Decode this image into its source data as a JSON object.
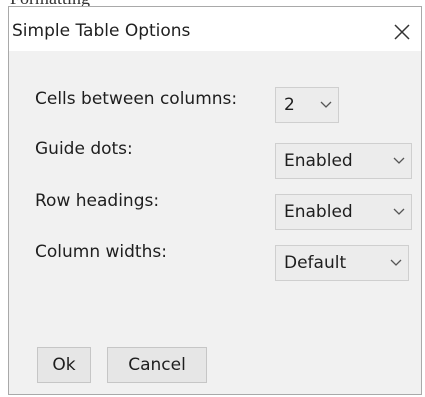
{
  "page_top_text": "Formatting",
  "dialog": {
    "title": "Simple Table Options",
    "close_icon": "close-x-icon"
  },
  "options": [
    {
      "label": "Cells between columns:",
      "value": "2"
    },
    {
      "label": "Guide dots:",
      "value": "Enabled"
    },
    {
      "label": "Row headings:",
      "value": "Enabled"
    },
    {
      "label": "Column widths:",
      "value": "Default"
    }
  ],
  "dropdown_icon": "chevron-down-icon",
  "buttons": {
    "ok_label": "Ok",
    "cancel_label": "Cancel"
  }
}
